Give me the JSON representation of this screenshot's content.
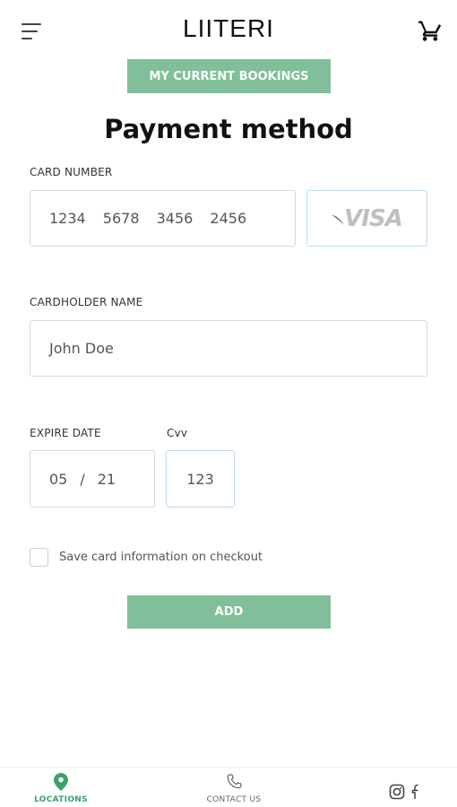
{
  "header": {
    "brand": "LIITERI",
    "menu_icon": "hamburger-menu-icon",
    "cart_icon": "shopping-cart-icon"
  },
  "bookings_button": "MY CURRENT BOOKINGS",
  "title": "Payment method",
  "form": {
    "card_number": {
      "label": "CARD NUMBER",
      "value": "1234 5678 3456 2456"
    },
    "card_brand": "VISA",
    "cardholder": {
      "label": "CARDHOLDER NAME",
      "value": "John Doe"
    },
    "expire": {
      "label": "EXPIRE DATE",
      "month": "05",
      "separator": "/",
      "year": "21"
    },
    "cvv": {
      "label": "Cvv",
      "value": "123"
    },
    "save_card": {
      "label": "Save card information on checkout",
      "checked": false
    },
    "add_button": "ADD"
  },
  "bottom_nav": {
    "locations": "LOCATIONS",
    "contact": "CONTACT US",
    "social": [
      "instagram-icon",
      "facebook-icon"
    ]
  },
  "colors": {
    "accent": "#80bf99",
    "active_nav": "#3aa26a"
  }
}
